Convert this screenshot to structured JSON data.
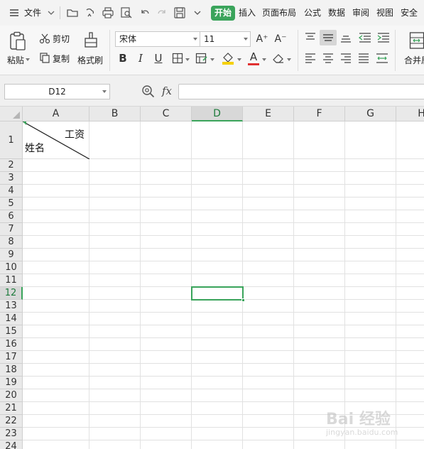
{
  "menubar": {
    "file_label": "文件",
    "tabs": [
      "开始",
      "插入",
      "页面布局",
      "公式",
      "数据",
      "审阅",
      "视图",
      "安全"
    ],
    "active_tab": "开始"
  },
  "ribbon": {
    "paste_label": "粘贴",
    "cut_label": "剪切",
    "copy_label": "复制",
    "format_painter_label": "格式刷",
    "font_name": "宋体",
    "font_size": "11",
    "grow_font_icon": "A⁺",
    "shrink_font_icon": "A⁻",
    "bold": "B",
    "italic": "I",
    "underline": "U",
    "font_color_letter": "A",
    "merge_label": "合并居"
  },
  "formula_bar": {
    "name_box": "D12",
    "fx_label": "fx",
    "formula": ""
  },
  "grid": {
    "columns": [
      "A",
      "B",
      "C",
      "D",
      "E",
      "F",
      "G",
      "H"
    ],
    "rows": [
      "1",
      "2",
      "3",
      "4",
      "5",
      "6",
      "7",
      "8",
      "9",
      "10",
      "11",
      "12",
      "13",
      "14",
      "15",
      "16",
      "17",
      "18",
      "19",
      "20",
      "21",
      "22",
      "23",
      "24"
    ],
    "selected_column": "D",
    "selected_row": "12",
    "cell_a1_top_right": "工资",
    "cell_a1_bottom_left": "姓名"
  },
  "watermark": {
    "logo": "Bai 经验",
    "domain": "jingyan.baidu.com"
  },
  "colors": {
    "accent": "#3aa45b",
    "font_color_bar": "#e03030",
    "fill_color_bar": "#f5d000"
  }
}
